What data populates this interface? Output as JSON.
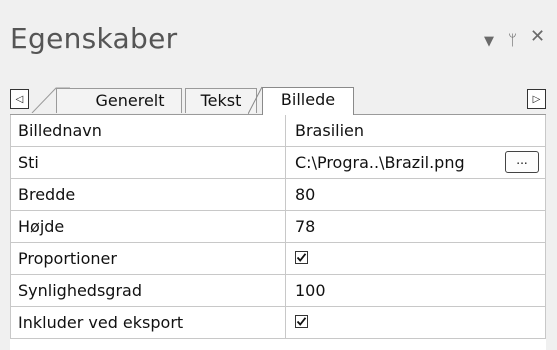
{
  "panel": {
    "title": "Egenskaber",
    "header_icons": [
      "dropdown-arrow-icon",
      "pin-icon",
      "close-icon"
    ]
  },
  "tabs": {
    "scroll_left": "◁",
    "scroll_right": "▷",
    "items": [
      {
        "label": "Generelt",
        "active": false
      },
      {
        "label": "Tekst",
        "active": false
      },
      {
        "label": "Billede",
        "active": true
      }
    ]
  },
  "properties": [
    {
      "name": "Billednavn",
      "value": "Brasilien",
      "type": "text"
    },
    {
      "name": "Sti",
      "value": "C:\\Progra..\\Brazil.png",
      "type": "path",
      "button": "..."
    },
    {
      "name": "Bredde",
      "value": "80",
      "type": "text"
    },
    {
      "name": "Højde",
      "value": "78",
      "type": "text"
    },
    {
      "name": "Proportioner",
      "value": "",
      "type": "checkbox",
      "checked": true
    },
    {
      "name": "Synlighedsgrad",
      "value": "100",
      "type": "text"
    },
    {
      "name": "Inkluder ved eksport",
      "value": "",
      "type": "checkbox",
      "checked": true
    }
  ]
}
